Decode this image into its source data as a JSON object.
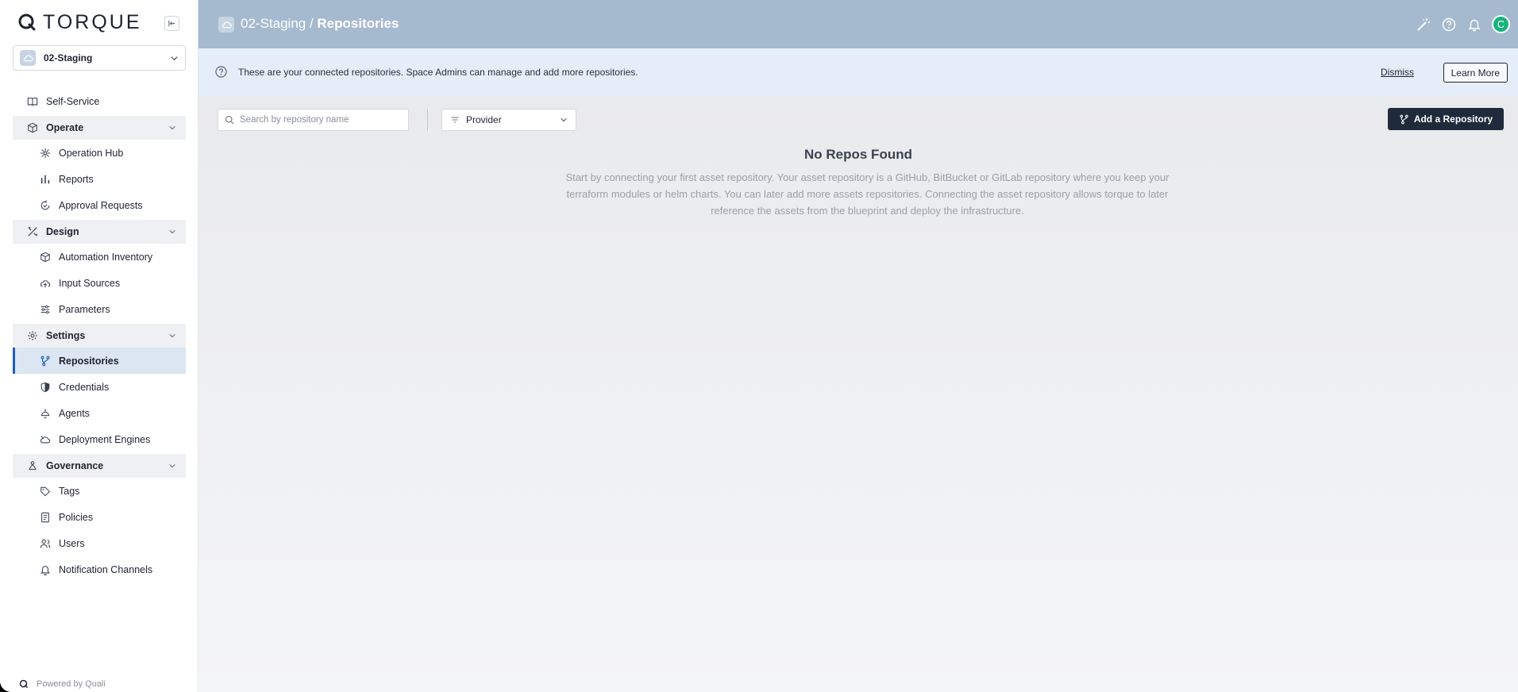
{
  "brand": {
    "name": "TORQUE"
  },
  "space_selector": {
    "value": "02-Staging"
  },
  "sidebar": {
    "self_service": "Self-Service",
    "groups": [
      {
        "label": "Operate",
        "items": [
          "Operation Hub",
          "Reports",
          "Approval Requests"
        ]
      },
      {
        "label": "Design",
        "items": [
          "Automation Inventory",
          "Input Sources",
          "Parameters"
        ]
      },
      {
        "label": "Settings",
        "items": [
          "Repositories",
          "Credentials",
          "Agents",
          "Deployment Engines"
        ]
      },
      {
        "label": "Governance",
        "items": [
          "Tags",
          "Policies",
          "Users",
          "Notification Channels"
        ]
      }
    ],
    "active_item": "Repositories"
  },
  "footer": {
    "powered_by": "Powered by Quali"
  },
  "header": {
    "space": "02-Staging",
    "separator": " / ",
    "page": "Repositories",
    "avatar_initial": "C"
  },
  "banner": {
    "text": "These are your connected repositories. Space Admins can manage and add more repositories.",
    "dismiss": "Dismiss",
    "learn_more": "Learn More"
  },
  "toolbar": {
    "search_placeholder": "Search by repository name",
    "provider_label": "Provider",
    "add_button": "Add a Repository"
  },
  "empty_state": {
    "title": "No Repos Found",
    "description": "Start by connecting your first asset repository. Your asset repository is a GitHub, BitBucket or GitLab repository where you keep your terraform modules or helm charts. You can later add more assets repositories. Connecting the asset repository allows torque to later reference the assets from the blueprint and deploy the infrastructure."
  },
  "colors": {
    "topbar": "#a6bacf",
    "banner": "#e5eef8",
    "active_item_bg": "#dbe6f2",
    "active_indicator": "#1d5dbd",
    "primary_button": "#1f2a3a",
    "avatar": "#17b27e"
  }
}
